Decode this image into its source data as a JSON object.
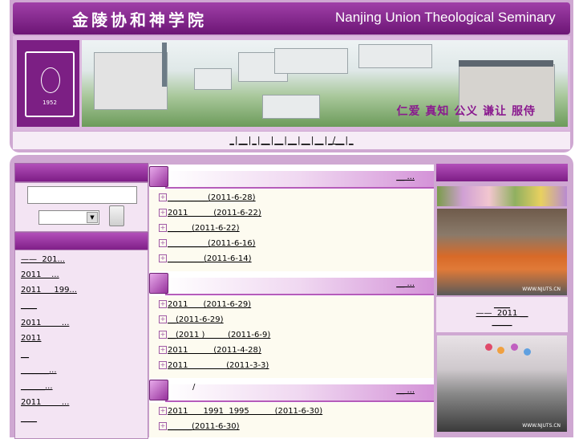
{
  "header": {
    "title_cn": "金陵协和神学院",
    "title_en": "Nanjing Union Theological Seminary",
    "motto": "仁爱  真知  公义  谦让  服侍",
    "seal_year": "1952",
    "nav": [
      "_",
      "__",
      "_",
      "__",
      "__",
      "__",
      "__",
      "__",
      "_/__",
      "_"
    ]
  },
  "left": {
    "search_placeholder": "",
    "items": [
      "——  201...",
      "2011    ...",
      "2011     199...",
      "____",
      "2011        ...",
      "2011",
      "__",
      "_______...",
      "______...",
      "2011        ...",
      "____"
    ]
  },
  "sections": [
    {
      "more": "__ ...",
      "slash": "",
      "items": [
        {
          "text": "__________(2011-6-28)"
        },
        {
          "text": "2011          (2011-6-22)"
        },
        {
          "text": "______(2011-6-22)"
        },
        {
          "text": "__________(2011-6-16)"
        },
        {
          "text": "_________(2011-6-14)"
        }
      ]
    },
    {
      "more": "__ ...",
      "slash": "",
      "items": [
        {
          "text": "2011      (2011-6-29)"
        },
        {
          "text": "__(2011-6-29)"
        },
        {
          "text": "__(2011 )         (2011-6-9)"
        },
        {
          "text": "2011          (2011-4-28)"
        },
        {
          "text": "2011               (2011-3-3)"
        }
      ]
    },
    {
      "more": "__ ...",
      "slash": "/",
      "items": [
        {
          "text": "2011      1991  1995          (2011-6-30)"
        },
        {
          "text": "______(2011-6-30)"
        }
      ]
    }
  ],
  "right": {
    "caption_lines": [
      "____",
      "——  2011 __",
      "_____"
    ],
    "watermark": "WWW.NJUTS.CN"
  }
}
